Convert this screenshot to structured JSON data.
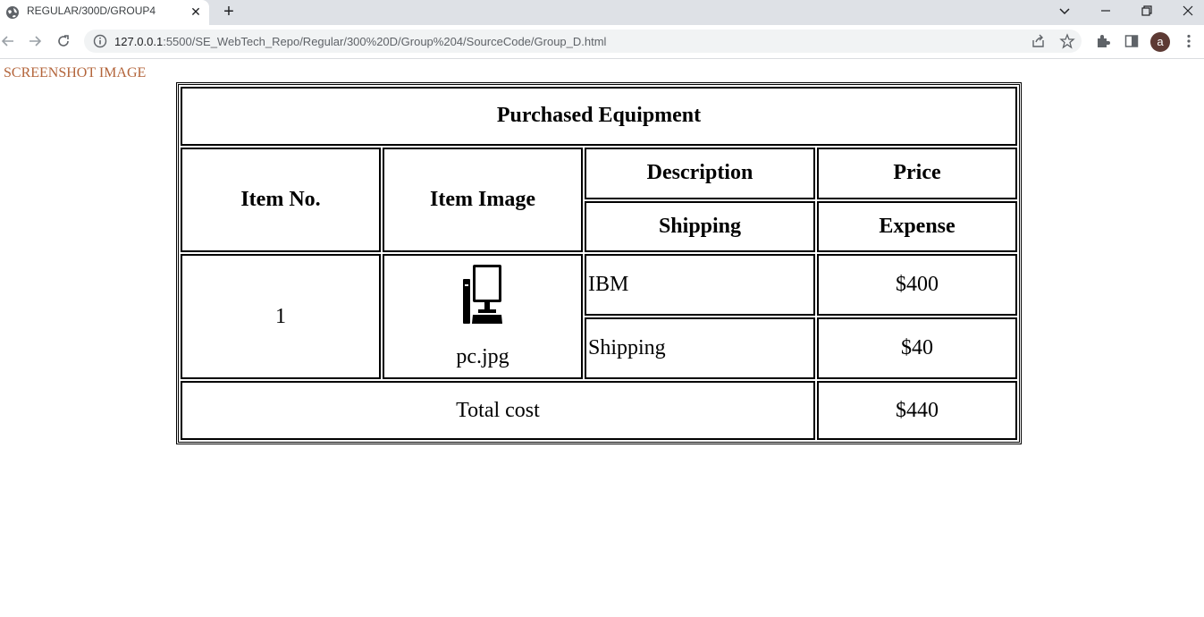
{
  "browser": {
    "tab_title": "REGULAR/300D/GROUP4",
    "url_host": "127.0.0.1",
    "url_rest": ":5500/SE_WebTech_Repo/Regular/300%20D/Group%204/SourceCode/Group_D.html",
    "avatar_letter": "a"
  },
  "page": {
    "screenshot_label": "SCREENSHOT IMAGE",
    "table": {
      "caption": "Purchased Equipment",
      "headers": {
        "item_no": "Item No.",
        "item_image": "Item Image",
        "description": "Description",
        "price": "Price",
        "shipping": "Shipping",
        "expense": "Expense"
      },
      "rows": [
        {
          "item_no": "1",
          "image_alt": "pc.jpg",
          "description": "IBM",
          "price": "$400",
          "shipping_label": "Shipping",
          "shipping_cost": "$40"
        }
      ],
      "total_label": "Total cost",
      "total_value": "$440"
    }
  },
  "colors": {
    "tabstrip": "#dee1e6",
    "label_color": "#b3643a",
    "avatar": "#5d3a34"
  }
}
